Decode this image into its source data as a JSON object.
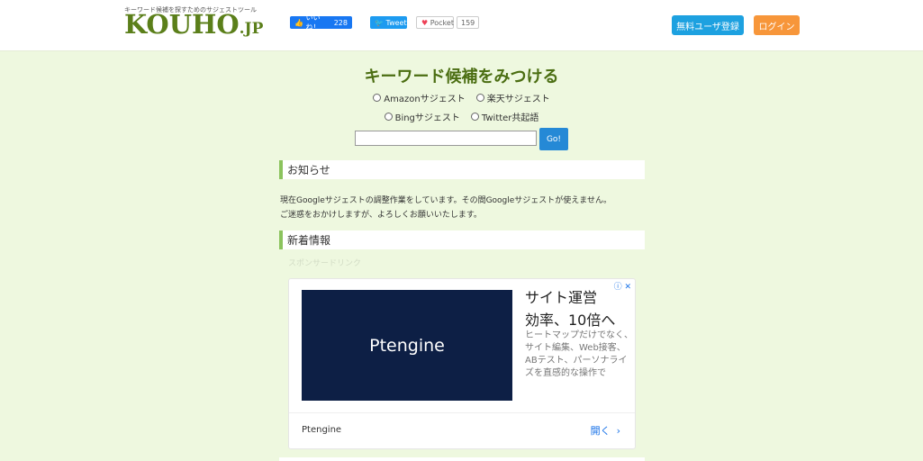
{
  "header": {
    "tagline": "キーワード候補を探すためのサジェストツール",
    "logo": "KOUHO",
    "logo_suffix": ".JP",
    "fb_label": "いいね！",
    "fb_count": "228",
    "tweet_label": "Tweet",
    "pocket_label": "Pocket",
    "pocket_count": "159",
    "register_label": "無料ユーザ登録",
    "login_label": "ログイン"
  },
  "search": {
    "title": "キーワード候補をみつける",
    "options": [
      "Amazonサジェスト",
      "楽天サジェスト",
      "Bingサジェスト",
      "Twitter共起語"
    ],
    "input_value": "",
    "go_label": "Go!"
  },
  "notice": {
    "heading": "お知らせ",
    "line1": "現在Googleサジェストの調整作業をしています。その間Googleサジェストが使えません。",
    "line2": "ご迷惑をおかけしますが、よろしくお願いいたします。"
  },
  "news": {
    "heading": "新着情報",
    "sponsor_label": "スポンサードリンク"
  },
  "ad": {
    "banner_text": "Ptengine",
    "headline_1": "サイト運営",
    "headline_2": "効率、10倍へ",
    "body": "ヒートマップだけでなく、サイト編集、Web接客、ABテスト、パーソナライズを直感的な操作で",
    "advertiser": "Ptengine",
    "open_label": "開く",
    "icons": "ⓘ ✕"
  },
  "colors": {
    "page_bg": "#eef8df",
    "brand_green": "#5b7f1a",
    "register_blue": "#1da1e0",
    "login_orange": "#f7963a"
  }
}
